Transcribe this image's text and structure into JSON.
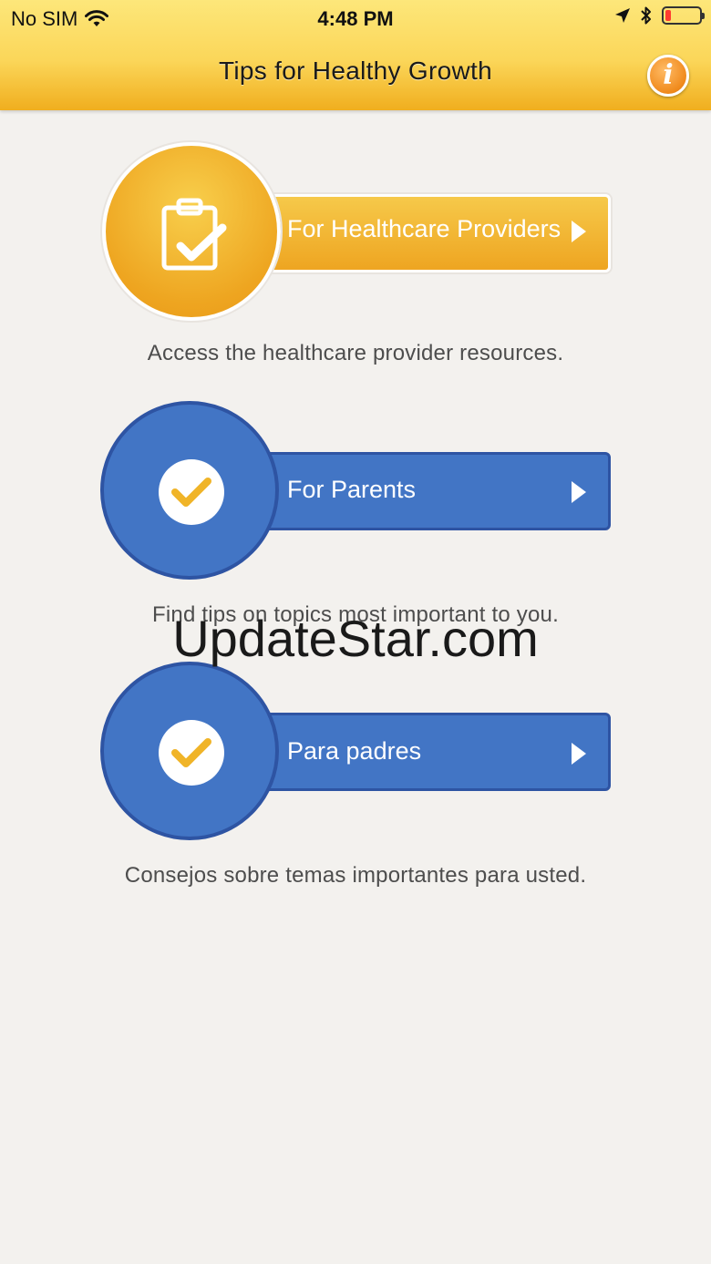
{
  "status_bar": {
    "carrier": "No SIM",
    "time": "4:48 PM"
  },
  "header": {
    "title": "Tips for Healthy Growth",
    "info_icon": "info-icon",
    "info_glyph": "i"
  },
  "buttons": [
    {
      "label": "For Healthcare Providers",
      "description": "Access the healthcare provider resources.",
      "icon": "clipboard-check-icon",
      "color": "#f0ad22"
    },
    {
      "label": "For Parents",
      "description": "Find tips on topics most important to you.",
      "icon": "checkmark-icon",
      "color": "#4275c5"
    },
    {
      "label": "Para padres",
      "description": "Consejos sobre temas importantes para usted.",
      "icon": "checkmark-icon",
      "color": "#4275c5"
    }
  ],
  "watermark": "UpdateStar.com"
}
